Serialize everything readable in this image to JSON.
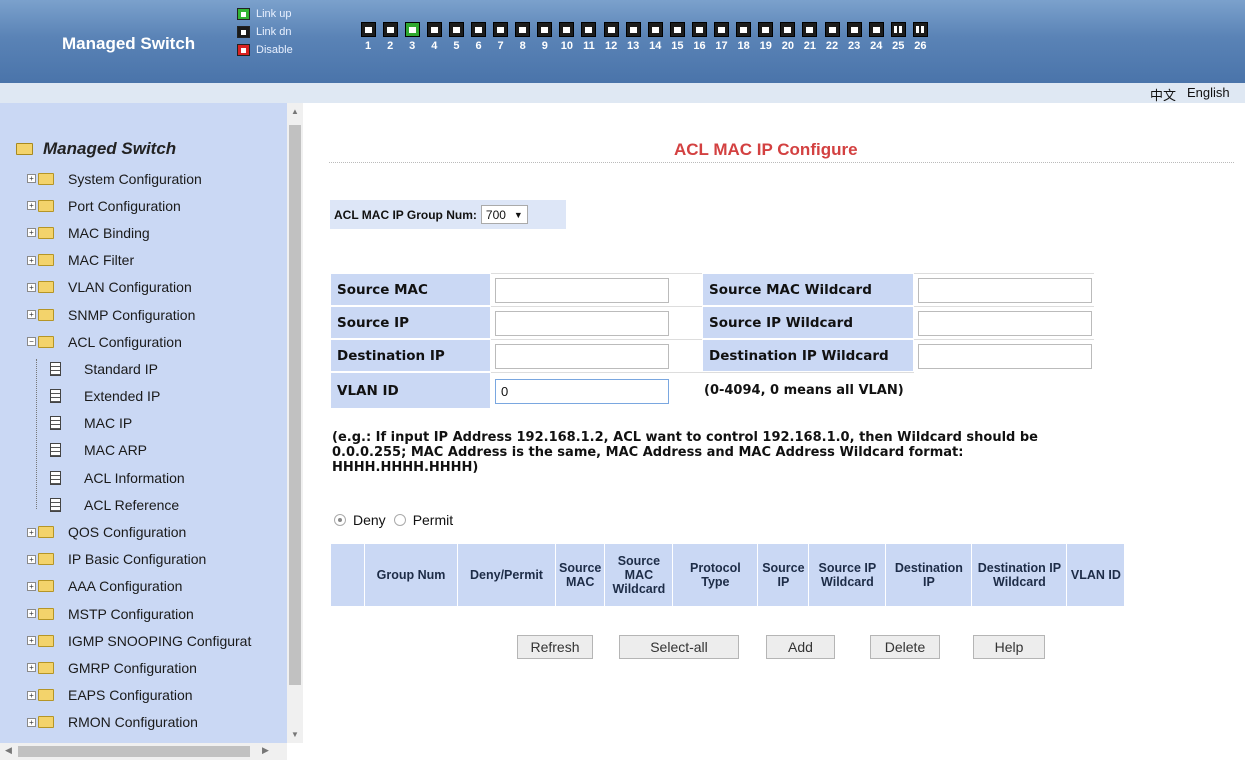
{
  "header": {
    "brand": "Managed Switch",
    "legend": [
      {
        "label": "Link up",
        "state": "up"
      },
      {
        "label": "Link dn",
        "state": "down"
      },
      {
        "label": "Disable",
        "state": "disabled"
      }
    ],
    "ports": [
      {
        "num": "1",
        "state": "down"
      },
      {
        "num": "2",
        "state": "down"
      },
      {
        "num": "3",
        "state": "up"
      },
      {
        "num": "4",
        "state": "down"
      },
      {
        "num": "5",
        "state": "down"
      },
      {
        "num": "6",
        "state": "down"
      },
      {
        "num": "7",
        "state": "down"
      },
      {
        "num": "8",
        "state": "down"
      },
      {
        "num": "9",
        "state": "down"
      },
      {
        "num": "10",
        "state": "down"
      },
      {
        "num": "11",
        "state": "down"
      },
      {
        "num": "12",
        "state": "down"
      },
      {
        "num": "13",
        "state": "down"
      },
      {
        "num": "14",
        "state": "down"
      },
      {
        "num": "15",
        "state": "down"
      },
      {
        "num": "16",
        "state": "down"
      },
      {
        "num": "17",
        "state": "down"
      },
      {
        "num": "18",
        "state": "down"
      },
      {
        "num": "19",
        "state": "down"
      },
      {
        "num": "20",
        "state": "down"
      },
      {
        "num": "21",
        "state": "down"
      },
      {
        "num": "22",
        "state": "down"
      },
      {
        "num": "23",
        "state": "down"
      },
      {
        "num": "24",
        "state": "down"
      },
      {
        "num": "25",
        "state": "sfp"
      },
      {
        "num": "26",
        "state": "sfp"
      }
    ],
    "colors": {
      "link_up": "#2fa82f",
      "link_dn": "#1c1c1c",
      "disable": "#d82121"
    }
  },
  "lang": {
    "cn": "中文",
    "en": "English"
  },
  "sidebar": {
    "root": "Managed Switch",
    "items": [
      {
        "label": "System Configuration",
        "type": "folder"
      },
      {
        "label": "Port Configuration",
        "type": "folder"
      },
      {
        "label": "MAC Binding",
        "type": "folder"
      },
      {
        "label": "MAC Filter",
        "type": "folder"
      },
      {
        "label": "VLAN Configuration",
        "type": "folder"
      },
      {
        "label": "SNMP Configuration",
        "type": "folder"
      },
      {
        "label": "ACL Configuration",
        "type": "folder-open"
      },
      {
        "label": "Standard IP",
        "type": "page"
      },
      {
        "label": "Extended IP",
        "type": "page"
      },
      {
        "label": "MAC IP",
        "type": "page"
      },
      {
        "label": "MAC ARP",
        "type": "page"
      },
      {
        "label": "ACL Information",
        "type": "page"
      },
      {
        "label": "ACL Reference",
        "type": "page"
      },
      {
        "label": "QOS Configuration",
        "type": "folder"
      },
      {
        "label": "IP Basic Configuration",
        "type": "folder"
      },
      {
        "label": "AAA Configuration",
        "type": "folder"
      },
      {
        "label": "MSTP Configuration",
        "type": "folder"
      },
      {
        "label": "IGMP SNOOPING Configurat",
        "type": "folder"
      },
      {
        "label": "GMRP Configuration",
        "type": "folder"
      },
      {
        "label": "EAPS Configuration",
        "type": "folder"
      },
      {
        "label": "RMON Configuration",
        "type": "folder"
      }
    ]
  },
  "main": {
    "title": "ACL MAC IP Configure",
    "group_label": "ACL MAC IP Group Num:",
    "group_value": "700",
    "fields": {
      "source_mac": {
        "label": "Source MAC",
        "value": ""
      },
      "source_mac_wildcard": {
        "label": "Source MAC Wildcard",
        "value": ""
      },
      "source_ip": {
        "label": "Source IP",
        "value": ""
      },
      "source_ip_wildcard": {
        "label": "Source IP Wildcard",
        "value": ""
      },
      "destination_ip": {
        "label": "Destination IP",
        "value": ""
      },
      "destination_ip_wildcard": {
        "label": "Destination IP Wildcard",
        "value": ""
      },
      "vlan_id": {
        "label": "VLAN ID",
        "value": "0",
        "note": "(0-4094, 0 means all VLAN)"
      }
    },
    "hint": "(e.g.: If input IP Address 192.168.1.2, ACL want to control 192.168.1.0, then Wildcard should be 0.0.0.255; MAC Address is the same, MAC Address and MAC Address Wildcard format: HHHH.HHHH.HHHH)",
    "radios": {
      "deny": "Deny",
      "permit": "Permit",
      "selected": "deny"
    },
    "table_headers": [
      "",
      "Group Num",
      "Deny/Permit",
      "Source MAC",
      "Source MAC Wildcard",
      "Protocol Type",
      "Source IP",
      "Source IP Wildcard",
      "Destination IP",
      "Destination IP Wildcard",
      "VLAN ID"
    ],
    "buttons": {
      "refresh": "Refresh",
      "select_all": "Select-all",
      "add": "Add",
      "delete": "Delete",
      "help": "Help"
    }
  }
}
